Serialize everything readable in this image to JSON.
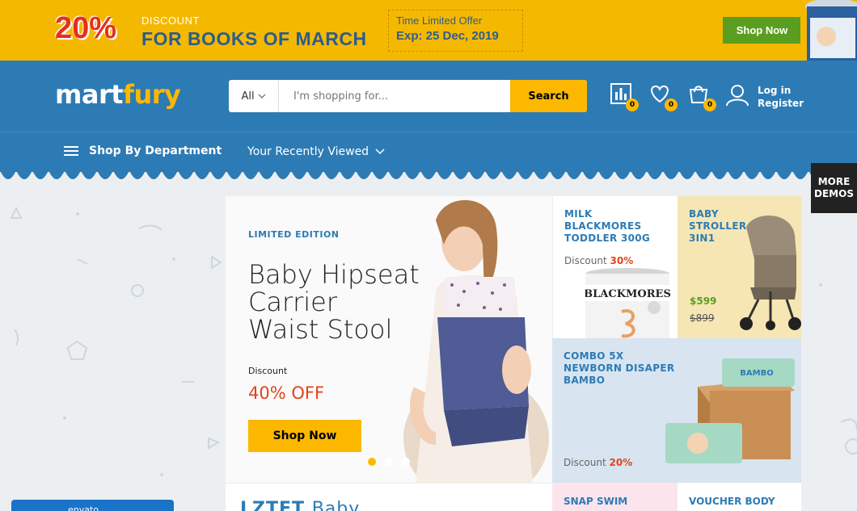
{
  "promo": {
    "percent": "20%",
    "discount_label": "DISCOUNT",
    "headline": "FOR BOOKS OF MARCH",
    "offer_line1": "Time Limited Offer",
    "offer_line2": "Exp: 25 Dec, 2019",
    "button": "Shop Now"
  },
  "header": {
    "logo_part1": "mart",
    "logo_part2": "fury",
    "search_category": "All",
    "search_placeholder": "I'm shopping for...",
    "search_button": "Search",
    "compare_count": "0",
    "wishlist_count": "0",
    "cart_count": "0",
    "login": "Log in",
    "register": "Register"
  },
  "nav": {
    "department": "Shop By Department",
    "recent": "Your Recently Viewed"
  },
  "more_demos": {
    "line1": "MORE",
    "line2": "DEMOS"
  },
  "banner": {
    "label": "LIMITED EDITION",
    "title_line1": "Baby Hipseat",
    "title_line2": "Carrier",
    "title_line3": "Waist Stool",
    "discount_label": "Discount",
    "discount_value": "40% OFF",
    "button": "Shop Now"
  },
  "tiles": {
    "t1": {
      "line1": "MILK",
      "line2": "BLACKMORES",
      "line3": "TODDLER 300G",
      "discount_label": "Discount",
      "discount_value": "30%",
      "brand": "BLACKMORES"
    },
    "t2": {
      "line1": "BABY",
      "line2": "STROLLER",
      "line3": "3IN1",
      "price": "$599",
      "old_price": "$899"
    },
    "t3": {
      "line1": "COMBO 5X",
      "line2": "NEWBORN DISAPER",
      "line3": "BAMBO",
      "discount_label": "Discount",
      "discount_value": "20%",
      "brand": "BAMBO"
    }
  },
  "bottom": {
    "b1_bold": "LZTET",
    "b1_light": "Baby",
    "b2": "SNAP SWIM",
    "b3": "VOUCHER BODY"
  },
  "envato": "envato"
}
